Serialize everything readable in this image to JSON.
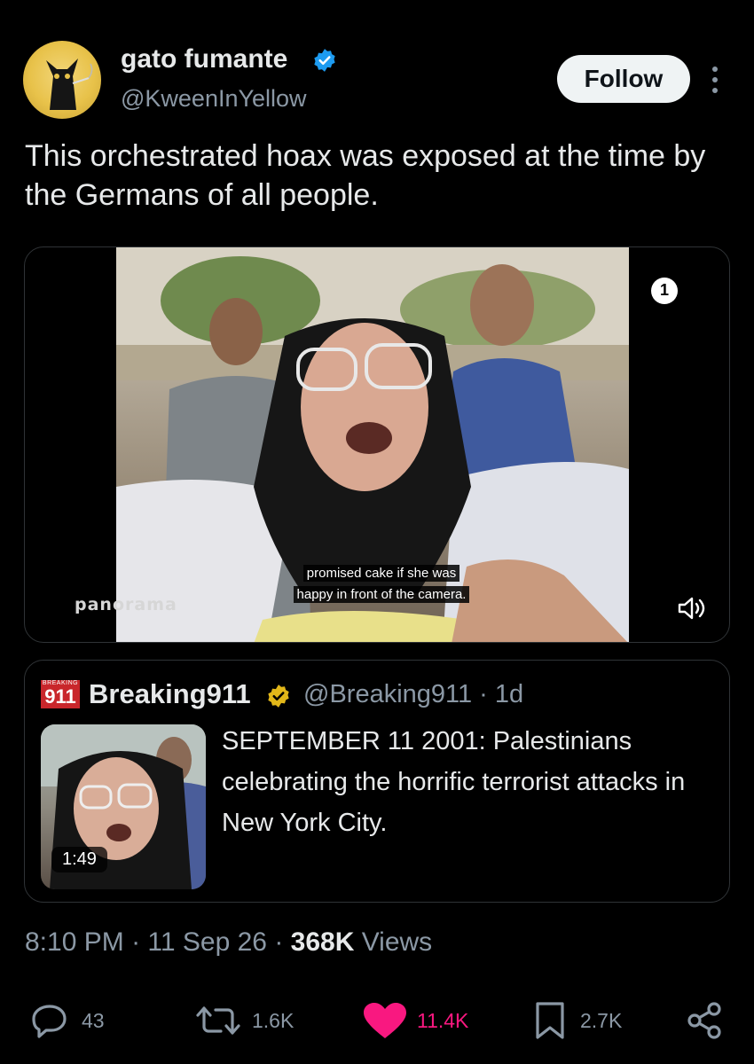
{
  "author": {
    "name": "gato fumante",
    "handle": "@KweenInYellow",
    "verified": true
  },
  "follow_button": {
    "label": "Follow"
  },
  "tweet": {
    "text": "This orchestrated hoax was exposed at the time by the Germans of all people."
  },
  "video": {
    "caption_line1": "promised cake if she was",
    "caption_line2": "happy in front of the camera.",
    "watermark": "panorama",
    "channel_mark": "1"
  },
  "quoted_tweet": {
    "logo_small": "BREAKING",
    "logo_big": "911",
    "name": "Breaking911",
    "handle_time": "@Breaking911 · 1d",
    "duration": "1:49",
    "text": "SEPTEMBER 11 2001: Palestinians celebrating the horrific terrorist attacks in New York City."
  },
  "meta": {
    "time": "8:10 PM",
    "date": "11 Sep 26",
    "views_count": "368K",
    "views_label": "Views"
  },
  "actions": {
    "replies": "43",
    "reposts": "1.6K",
    "likes": "11.4K",
    "bookmarks": "2.7K"
  },
  "colors": {
    "background": "#000000",
    "text_primary": "#e7e9ea",
    "text_secondary": "#8b98a5",
    "verified_blue": "#1d9bf0",
    "verified_gold": "#e2b719",
    "like_pink": "#f91880"
  }
}
